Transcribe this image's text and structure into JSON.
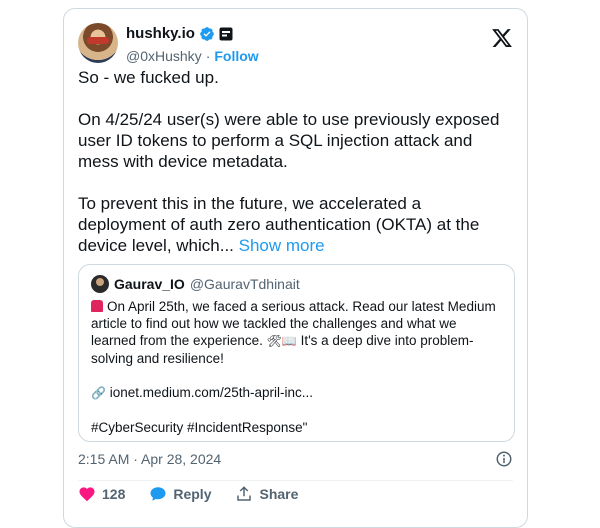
{
  "tweet": {
    "author_name": "hushky.io",
    "author_handle": "@0xHushky",
    "follow_label": "Follow",
    "sep": "·",
    "paragraphs": [
      "So - we fucked up.",
      "On 4/25/24 user(s) were able to use previously exposed user ID tokens to perform a SQL injection attack and mess with device metadata.",
      "To prevent this in the future, we accelerated a deployment of auth zero authentication (OKTA) at the device level, which..."
    ],
    "show_more_label": "Show more",
    "timestamp": "2:15 AM · Apr 28, 2024",
    "like_count": "128",
    "reply_label": "Reply",
    "share_label": "Share"
  },
  "quote": {
    "name": "Gaurav_IO",
    "handle": "@GauravTdhinait",
    "line1": "On April 25th, we faced a serious attack. Read our latest Medium article to find out how we tackled the challenges and what we learned from the experience.",
    "line1_tail": "It's a deep dive into problem-solving and resilience!",
    "link_text": "ionet.medium.com/25th-april-inc...",
    "hashtags": "#CyberSecurity #IncidentResponse\""
  },
  "icons": {
    "verified": "verified-badge-icon",
    "business": "business-badge-icon",
    "x_logo": "x-logo-icon",
    "info": "info-icon",
    "like": "heart-icon",
    "reply": "speech-bubble-icon",
    "share": "share-icon"
  },
  "colors": {
    "accent": "#1d9bf0",
    "like": "#f91880",
    "muted": "#536471",
    "border": "#cfd9de"
  }
}
